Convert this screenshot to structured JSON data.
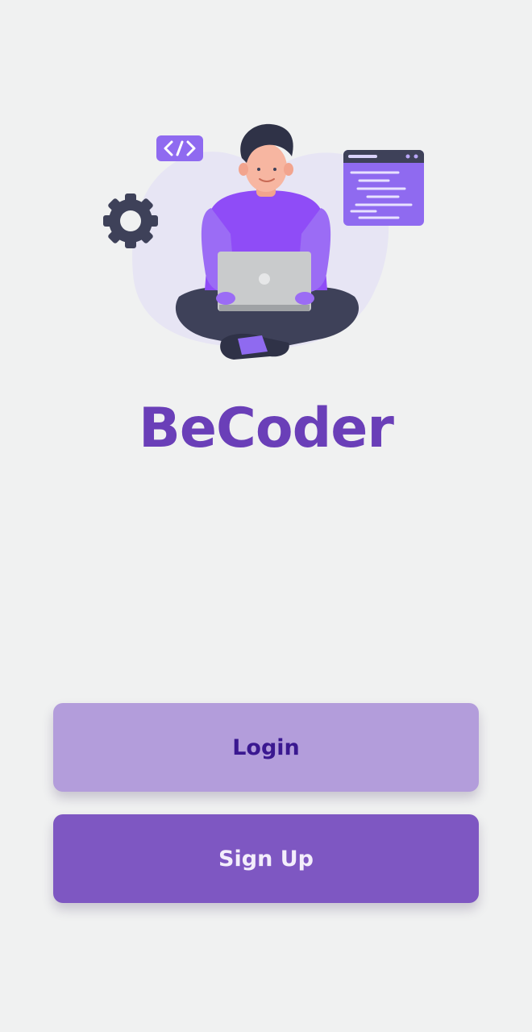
{
  "app": {
    "title": "BeCoder"
  },
  "hero": {
    "illustration": "developer-with-laptop-illustration",
    "icons": [
      "code-tag-icon",
      "gear-icon",
      "code-window-icon",
      "laptop-icon"
    ]
  },
  "actions": {
    "login_label": "Login",
    "signup_label": "Sign Up"
  },
  "colors": {
    "background": "#f0f1f1",
    "brand": "#6a3fb8",
    "login_bg": "#b39ddb",
    "login_text": "#3a1890",
    "signup_bg": "#7e57c2",
    "signup_text": "#f3eefb",
    "accent_purple": "#8a5cf6",
    "dark_navy": "#3e4159"
  }
}
